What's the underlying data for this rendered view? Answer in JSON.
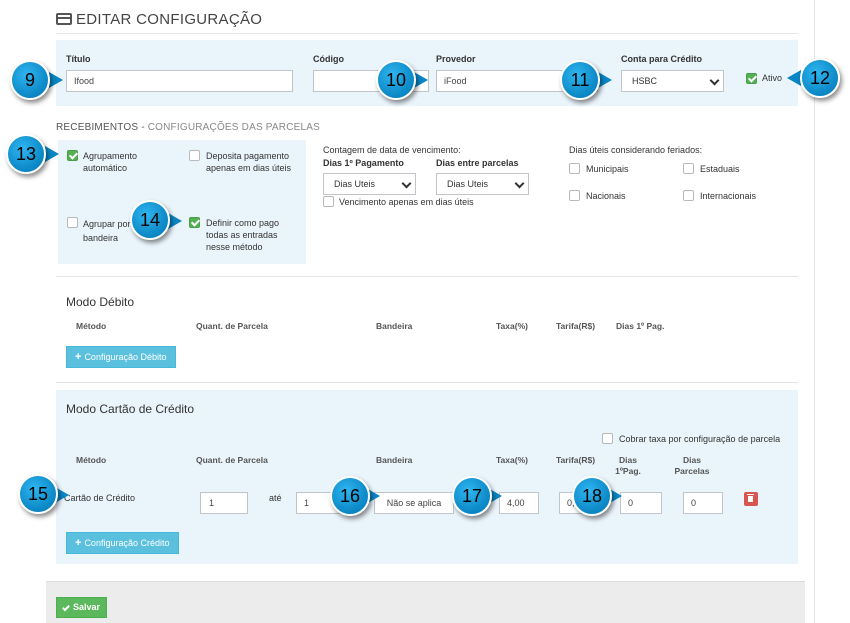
{
  "header": {
    "title": "EDITAR CONFIGURAÇÃO",
    "icon": "credit-card-icon"
  },
  "top_fields": {
    "titulo_label": "Título",
    "titulo_value": "Ifood",
    "codigo_label": "Código",
    "codigo_value": "",
    "provedor_label": "Provedor",
    "provedor_value": "iFood",
    "conta_label": "Conta para Crédito",
    "conta_value": "HSBC",
    "ativo_label": "Ativo"
  },
  "recebimentos": {
    "title": "RECEBIMENTOS",
    "separator": "-",
    "subtitle": "CONFIGURAÇÕES DAS PARCELAS",
    "agrupamento": "Agrupamento automático",
    "deposita": "Deposita pagamento apenas em dias úteis",
    "agrupar": "Agrupar por bandeira",
    "definir": "Definir como pago todas as entradas nesse método",
    "contagem_label": "Contagem de data de vencimento:",
    "dias1_label": "Dias 1º Pagamento",
    "dias1_value": "Dias Uteis",
    "entre_label": "Dias entre parcelas",
    "entre_value": "Dias Uteis",
    "vencimento": "Vencimento apenas em dias úteis",
    "feriados_label": "Dias úteis considerando feriados:",
    "municipais": "Municipais",
    "estaduais": "Estaduais",
    "nacionais": "Nacionais",
    "internacionais": "Internacionais"
  },
  "debito": {
    "title": "Modo Débito",
    "headers": [
      "Método",
      "Quant. de Parcela",
      "Bandeira",
      "Taxa(%)",
      "Tarifa(R$)",
      "Dias 1º Pag."
    ],
    "button": "Configuração Débito"
  },
  "credito": {
    "title": "Modo Cartão de Crédito",
    "cobrar": "Cobrar taxa por configuração de parcela",
    "headers": {
      "metodo": "Método",
      "quant": "Quant. de Parcela",
      "bandeira": "Bandeira",
      "taxa": "Taxa(%)",
      "tarifa": "Tarifa(R$)",
      "dias1_a": "Dias",
      "dias1_b": "1ºPag.",
      "diasp_a": "Dias",
      "diasp_b": "Parcelas"
    },
    "row": {
      "metodo": "Cartão de Crédito",
      "de": "1",
      "ate_label": "até",
      "ate": "1",
      "bandeira": "Não se aplica",
      "taxa": "4,00",
      "tarifa": "0,00",
      "dias1": "0",
      "diasp": "0"
    },
    "button": "Configuração Crédito"
  },
  "footer": {
    "save": "Salvar"
  },
  "callouts": [
    "9",
    "10",
    "11",
    "12",
    "13",
    "14",
    "15",
    "16",
    "17",
    "18"
  ],
  "colors": {
    "panel": "#eaf4fb",
    "callout": "#0a86c4",
    "save": "#5cb85c",
    "info": "#5bc0de",
    "danger": "#d9534f"
  }
}
